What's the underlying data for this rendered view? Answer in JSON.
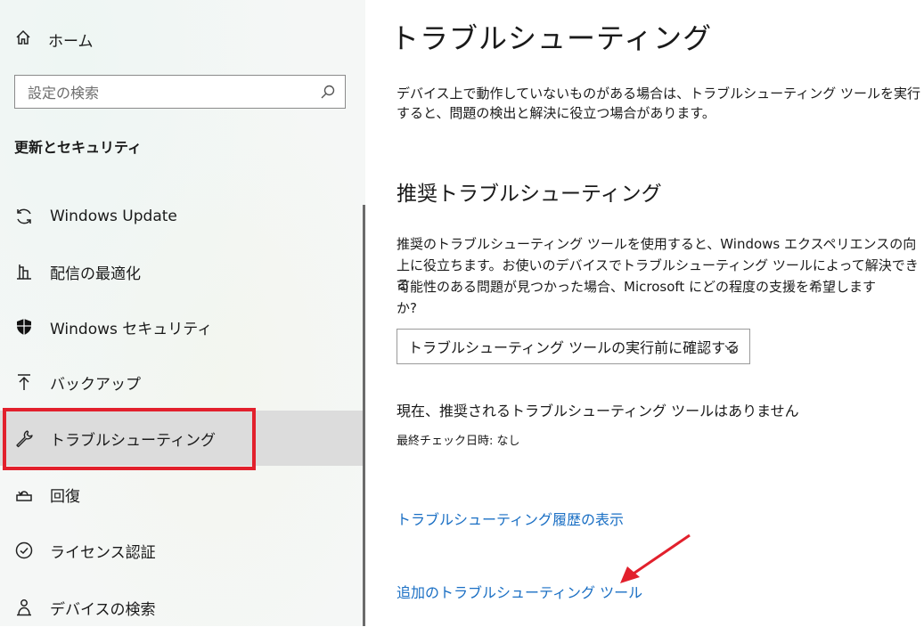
{
  "sidebar": {
    "home_label": "ホーム",
    "search_placeholder": "設定の検索",
    "section_title": "更新とセキュリティ",
    "items": [
      {
        "label": "Windows Update",
        "icon": "sync-icon"
      },
      {
        "label": "配信の最適化",
        "icon": "delivery-optimization-icon"
      },
      {
        "label": "Windows セキュリティ",
        "icon": "shield-icon"
      },
      {
        "label": "バックアップ",
        "icon": "backup-arrow-icon"
      },
      {
        "label": "トラブルシューティング",
        "icon": "wrench-icon",
        "selected": true
      },
      {
        "label": "回復",
        "icon": "recovery-icon"
      },
      {
        "label": "ライセンス認証",
        "icon": "check-circle-icon"
      },
      {
        "label": "デバイスの検索",
        "icon": "person-location-icon"
      }
    ]
  },
  "main": {
    "title": "トラブルシューティング",
    "intro_line1": "デバイス上で動作していないものがある場合は、トラブルシューティング ツールを実行",
    "intro_line2": "すると、問題の検出と解決に役立つ場合があります。",
    "recommended_heading": "推奨トラブルシューティング",
    "recommended_line1": "推奨のトラブルシューティング ツールを使用すると、Windows エクスペリエンスの向",
    "recommended_line2": "上に役立ちます。お使いのデバイスでトラブルシューティング ツールによって解決できる",
    "recommended_line3": "可能性のある問題が見つかった場合、Microsoft にどの程度の支援を希望します",
    "recommended_line4": "か?",
    "dropdown_value": "トラブルシューティング ツールの実行前に確認する",
    "status_text": "現在、推奨されるトラブルシューティング ツールはありません",
    "last_check": "最終チェック日時: なし",
    "history_link": "トラブルシューティング履歴の表示",
    "additional_link": "追加のトラブルシューティング ツール"
  },
  "colors": {
    "accent_link": "#1a6fc4",
    "highlight_border": "#e2202c",
    "selected_bg": "#dcdcdc"
  }
}
